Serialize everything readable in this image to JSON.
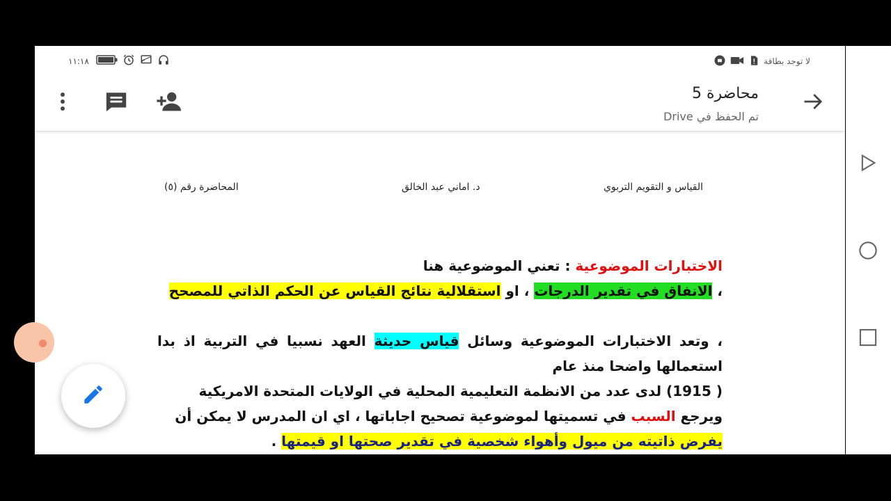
{
  "status_bar": {
    "time": "١١:١٨",
    "carrier": "لا توجد بطاقة"
  },
  "app_bar": {
    "title": "محاضرة 5",
    "subtitle": "تم الحفظ في Drive"
  },
  "document": {
    "header": {
      "course": "القياس و التقويم التربوي",
      "author": "د. اماني عبد الخالق",
      "lecture": "المحاضرة رقم (٥)"
    },
    "p1": {
      "term": "الاختبارات الموضوعية",
      "colon": " :  تعني الموضوعية هنا"
    },
    "p2": {
      "comma": "، ",
      "green": "الانفاق في تقدير الدرجات",
      "mid": " ، او ",
      "yellow": "استقلالية نتائج القياس عن الحكم الذاتي للمصحح"
    },
    "p3": {
      "start": "، وتعد الاختبارات الموضوعية وسائل ",
      "cyan": "قياس حديثة",
      "end": " العهد نسبيا في التربية اذ بدا استعمالها واضحا منذ عام"
    },
    "p4": "( 1915) لدى عدد من الانظمة التعليمية المحلية في الولايات المتحدة الامريكية",
    "p5": {
      "start": "ويرجع ",
      "red": "السبب",
      "end": " في تسميتها لموضوعية تصحيح اجاباتها ، اي ان المدرس لا يمكن أن "
    },
    "p6": {
      "yellow": "يفرض ذاتيته من ميول وأهواء شخصية في تقدير صحتها او قيمتها",
      "end": " ."
    }
  },
  "colors": {
    "highlight_yellow": "#ffff00",
    "highlight_green": "#22dd22",
    "highlight_cyan": "#00ffff",
    "accent_blue": "#1a73e8",
    "term_red": "#e01010"
  }
}
